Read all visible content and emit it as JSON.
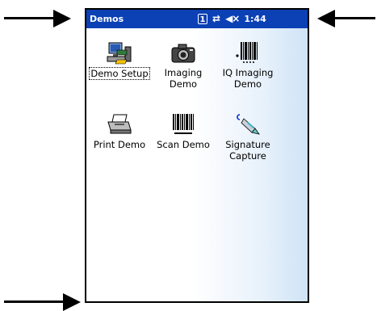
{
  "window": {
    "title": "Demos",
    "status": {
      "badge_number": "1",
      "clock": "1:44",
      "icons": [
        "number-badge-icon",
        "sync-arrows-icon",
        "speaker-muted-icon"
      ]
    }
  },
  "apps": [
    {
      "label": "Demo Setup",
      "icon": "computer-setup-icon",
      "selected": true
    },
    {
      "label": "Imaging Demo",
      "icon": "camera-icon",
      "selected": false
    },
    {
      "label": "IQ Imaging Demo",
      "icon": "barcode-iq-icon",
      "selected": false
    },
    {
      "label": "Print Demo",
      "icon": "printer-icon",
      "selected": false
    },
    {
      "label": "Scan Demo",
      "icon": "barcode-scan-icon",
      "selected": false
    },
    {
      "label": "Signature Capture",
      "icon": "pen-signature-icon",
      "selected": false
    }
  ],
  "colors": {
    "titlebar": "#0b41b5",
    "titlebar_text": "#ffffff",
    "background_gradient_end": "#cfe3f6",
    "annotation_arrows": "#000000"
  }
}
